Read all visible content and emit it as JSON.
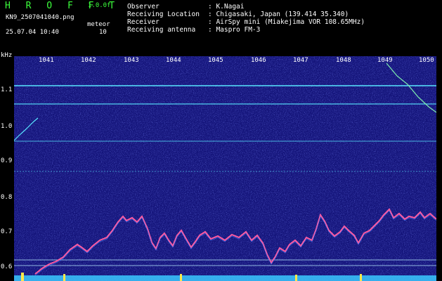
{
  "header": {
    "logo": "H R O F F T",
    "version": "1.0.0f",
    "filename": "KN9_2507041040.png",
    "meteor_label": "meteor",
    "meteor_count": "10",
    "datetime": "25.07.04 10:40",
    "info": [
      {
        "label": "Observer",
        "value": ": K.Nagai"
      },
      {
        "label": "Receiving Location",
        "value": ": Chigasaki, Japan (139.414 35.340)"
      },
      {
        "label": "Receiver",
        "value": ": AirSpy mini (Miakejima VOR 108.65MHz)"
      },
      {
        "label": "Receiving antenna",
        "value": ": Maspro FM-3"
      }
    ]
  },
  "axis": {
    "y_unit": "kHz",
    "y_ticks": [
      "1.1",
      "1.0",
      "0.9",
      "0.8",
      "0.7",
      "0.6"
    ],
    "x_ticks": [
      "1041",
      "1042",
      "1043",
      "1044",
      "1045",
      "1046",
      "1047",
      "1048",
      "1049",
      "1050"
    ]
  },
  "colors": {
    "background": "#14147a",
    "carrier_line": "#58e6ff",
    "trace": "#ff5aa0",
    "logo": "#3cff3c"
  }
}
